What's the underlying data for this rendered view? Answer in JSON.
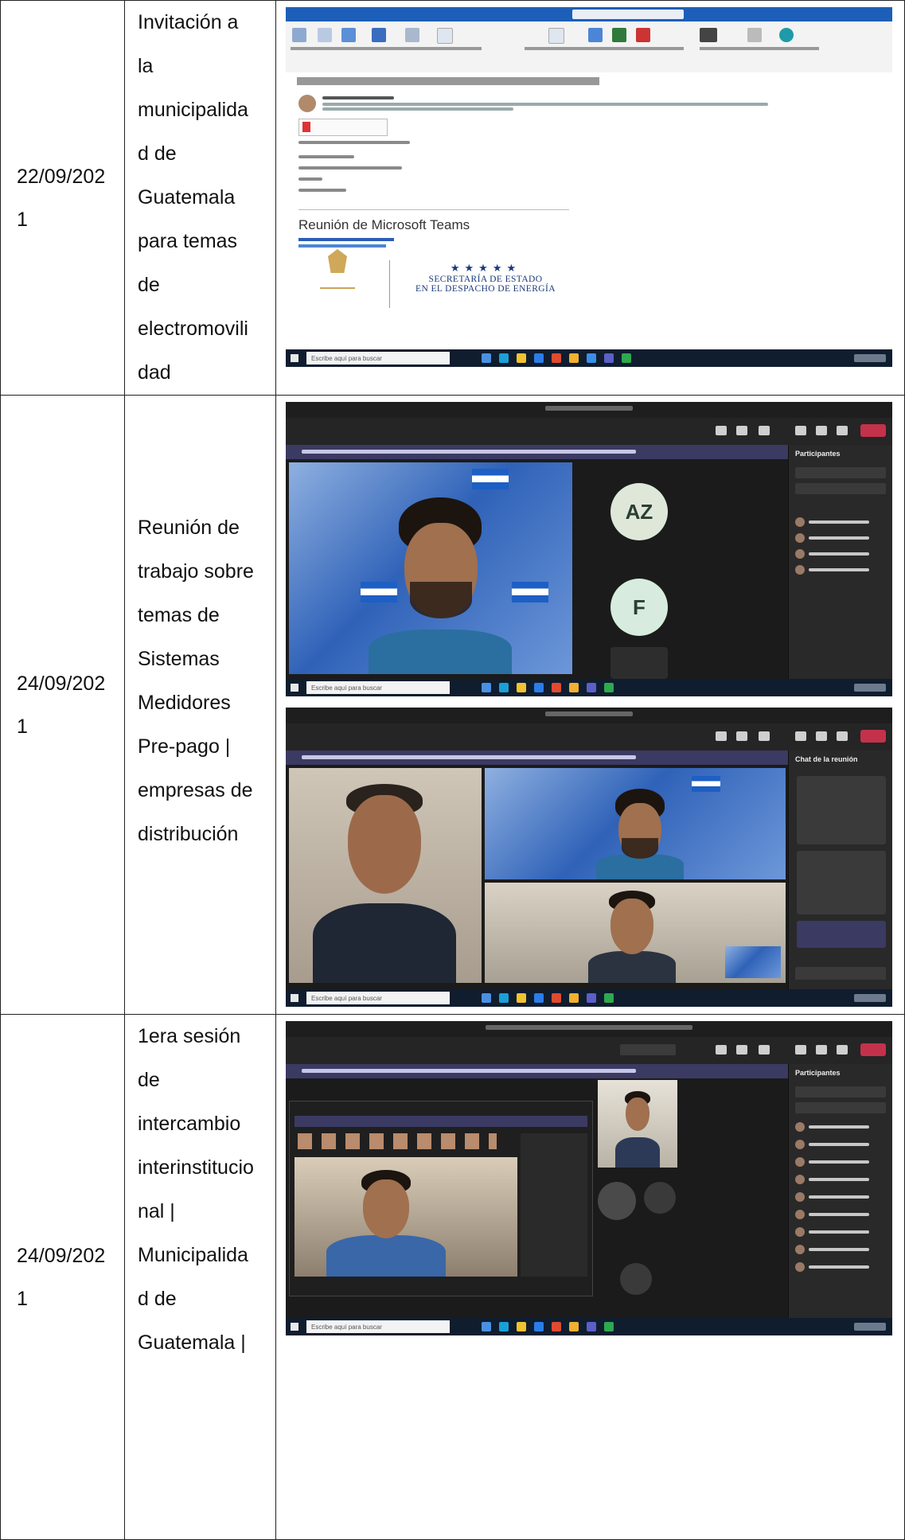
{
  "rows": [
    {
      "date": "22/09/202\n1",
      "description": "Invitación a\nla\nmunicipalida\nd de\nGuatemala\npara temas\nde\nelectromovili\ndad",
      "screenshot": {
        "teams_heading": "Reunión de Microsoft Teams",
        "logo_text": {
          "line1": "SECRETARÍA DE ESTADO",
          "line2": "EN EL DESPACHO DE ENERGÍA"
        },
        "search_placeholder": "Escribe aquí para buscar"
      }
    },
    {
      "date": "24/09/202\n1",
      "description": "Reunión de\ntrabajo sobre\ntemas de\nSistemas\nMedidores\nPre-pago |\nempresas de\ndistribución",
      "screenshots": [
        {
          "tile_initials": [
            "AZ",
            "F"
          ],
          "panel_title": "Participantes",
          "search_placeholder": "Escribe aquí para buscar"
        },
        {
          "panel_title": "Chat de la reunión",
          "search_placeholder": "Escribe aquí para buscar"
        }
      ]
    },
    {
      "date": "24/09/202\n1",
      "description": "1era sesión\nde\nintercambio\ninterinstitucio\nnal |\nMunicipalida\nd de\nGuatemala |",
      "screenshot": {
        "panel_title": "Participantes",
        "search_placeholder": "Escribe aquí para buscar"
      }
    }
  ],
  "colors": {
    "teams_leave": "#c4314b",
    "outlook_title": "#1d5fb8",
    "taskbar": "#0f1d2e"
  }
}
